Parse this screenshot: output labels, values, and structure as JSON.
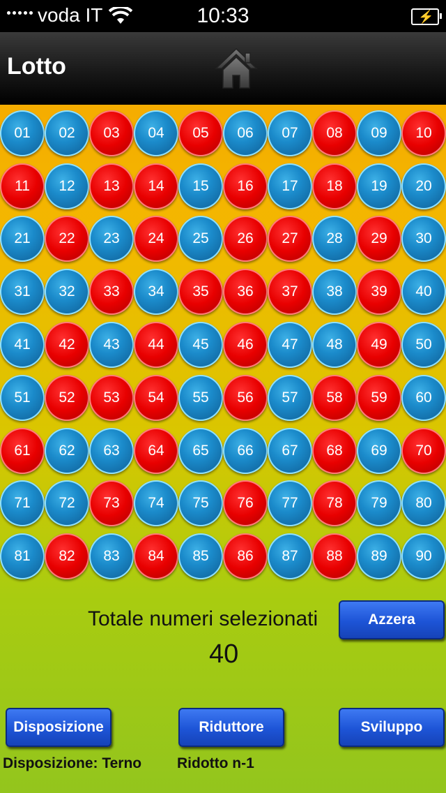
{
  "status_bar": {
    "carrier": "voda IT",
    "time": "10:33"
  },
  "nav": {
    "title": "Lotto",
    "home_icon": "home-icon"
  },
  "colors": {
    "blue_ball": "#1b8bcb",
    "red_ball": "#e80000",
    "button": "#1d54d6"
  },
  "numbers": [
    {
      "n": "01",
      "selected": false
    },
    {
      "n": "02",
      "selected": false
    },
    {
      "n": "03",
      "selected": true
    },
    {
      "n": "04",
      "selected": false
    },
    {
      "n": "05",
      "selected": true
    },
    {
      "n": "06",
      "selected": false
    },
    {
      "n": "07",
      "selected": false
    },
    {
      "n": "08",
      "selected": true
    },
    {
      "n": "09",
      "selected": false
    },
    {
      "n": "10",
      "selected": true
    },
    {
      "n": "11",
      "selected": true
    },
    {
      "n": "12",
      "selected": false
    },
    {
      "n": "13",
      "selected": true
    },
    {
      "n": "14",
      "selected": true
    },
    {
      "n": "15",
      "selected": false
    },
    {
      "n": "16",
      "selected": true
    },
    {
      "n": "17",
      "selected": false
    },
    {
      "n": "18",
      "selected": true
    },
    {
      "n": "19",
      "selected": false
    },
    {
      "n": "20",
      "selected": false
    },
    {
      "n": "21",
      "selected": false
    },
    {
      "n": "22",
      "selected": true
    },
    {
      "n": "23",
      "selected": false
    },
    {
      "n": "24",
      "selected": true
    },
    {
      "n": "25",
      "selected": false
    },
    {
      "n": "26",
      "selected": true
    },
    {
      "n": "27",
      "selected": true
    },
    {
      "n": "28",
      "selected": false
    },
    {
      "n": "29",
      "selected": true
    },
    {
      "n": "30",
      "selected": false
    },
    {
      "n": "31",
      "selected": false
    },
    {
      "n": "32",
      "selected": false
    },
    {
      "n": "33",
      "selected": true
    },
    {
      "n": "34",
      "selected": false
    },
    {
      "n": "35",
      "selected": true
    },
    {
      "n": "36",
      "selected": true
    },
    {
      "n": "37",
      "selected": true
    },
    {
      "n": "38",
      "selected": false
    },
    {
      "n": "39",
      "selected": true
    },
    {
      "n": "40",
      "selected": false
    },
    {
      "n": "41",
      "selected": false
    },
    {
      "n": "42",
      "selected": true
    },
    {
      "n": "43",
      "selected": false
    },
    {
      "n": "44",
      "selected": true
    },
    {
      "n": "45",
      "selected": false
    },
    {
      "n": "46",
      "selected": true
    },
    {
      "n": "47",
      "selected": false
    },
    {
      "n": "48",
      "selected": false
    },
    {
      "n": "49",
      "selected": true
    },
    {
      "n": "50",
      "selected": false
    },
    {
      "n": "51",
      "selected": false
    },
    {
      "n": "52",
      "selected": true
    },
    {
      "n": "53",
      "selected": true
    },
    {
      "n": "54",
      "selected": true
    },
    {
      "n": "55",
      "selected": false
    },
    {
      "n": "56",
      "selected": true
    },
    {
      "n": "57",
      "selected": false
    },
    {
      "n": "58",
      "selected": true
    },
    {
      "n": "59",
      "selected": true
    },
    {
      "n": "60",
      "selected": false
    },
    {
      "n": "61",
      "selected": true
    },
    {
      "n": "62",
      "selected": false
    },
    {
      "n": "63",
      "selected": false
    },
    {
      "n": "64",
      "selected": true
    },
    {
      "n": "65",
      "selected": false
    },
    {
      "n": "66",
      "selected": false
    },
    {
      "n": "67",
      "selected": false
    },
    {
      "n": "68",
      "selected": true
    },
    {
      "n": "69",
      "selected": false
    },
    {
      "n": "70",
      "selected": true
    },
    {
      "n": "71",
      "selected": false
    },
    {
      "n": "72",
      "selected": false
    },
    {
      "n": "73",
      "selected": true
    },
    {
      "n": "74",
      "selected": false
    },
    {
      "n": "75",
      "selected": false
    },
    {
      "n": "76",
      "selected": true
    },
    {
      "n": "77",
      "selected": false
    },
    {
      "n": "78",
      "selected": true
    },
    {
      "n": "79",
      "selected": false
    },
    {
      "n": "80",
      "selected": false
    },
    {
      "n": "81",
      "selected": false
    },
    {
      "n": "82",
      "selected": true
    },
    {
      "n": "83",
      "selected": false
    },
    {
      "n": "84",
      "selected": true
    },
    {
      "n": "85",
      "selected": false
    },
    {
      "n": "86",
      "selected": true
    },
    {
      "n": "87",
      "selected": false
    },
    {
      "n": "88",
      "selected": true
    },
    {
      "n": "89",
      "selected": false
    },
    {
      "n": "90",
      "selected": false
    }
  ],
  "summary": {
    "label": "Totale numeri selezionati",
    "count": "40"
  },
  "buttons": {
    "azzera": "Azzera",
    "disposizione": "Disposizione",
    "riduttore": "Riduttore",
    "sviluppo": "Sviluppo"
  },
  "info": {
    "disposizione": "Disposizione: Terno",
    "ridotto": "Ridotto n-1"
  }
}
